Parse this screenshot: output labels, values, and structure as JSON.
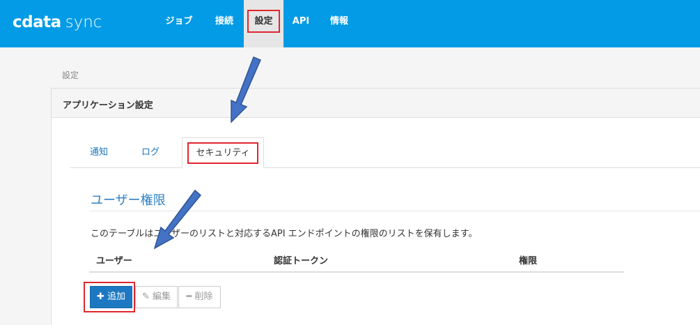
{
  "header": {
    "logo_left": "cdata",
    "logo_right": "sync",
    "nav": [
      {
        "label": "ジョブ"
      },
      {
        "label": "接続"
      },
      {
        "label": "設定"
      },
      {
        "label": "API"
      },
      {
        "label": "情報"
      }
    ]
  },
  "breadcrumb": "設定",
  "panel": {
    "title": "アプリケーション設定",
    "tabs": [
      {
        "label": "通知"
      },
      {
        "label": "ログ"
      },
      {
        "label": "セキュリティ"
      }
    ],
    "section_title": "ユーザー権限",
    "description": "このテーブルはユーザーのリストと対応するAPI エンドポイントの権限のリストを保有します。",
    "table": {
      "headers": [
        "ユーザー",
        "認証トークン",
        "権限"
      ]
    },
    "buttons": {
      "add": "追加",
      "edit": "編集",
      "delete": "削除"
    }
  },
  "colors": {
    "topbar": "#039be5",
    "highlight": "#e1262d",
    "primary": "#1d78c1",
    "arrow": "#4472c4"
  }
}
